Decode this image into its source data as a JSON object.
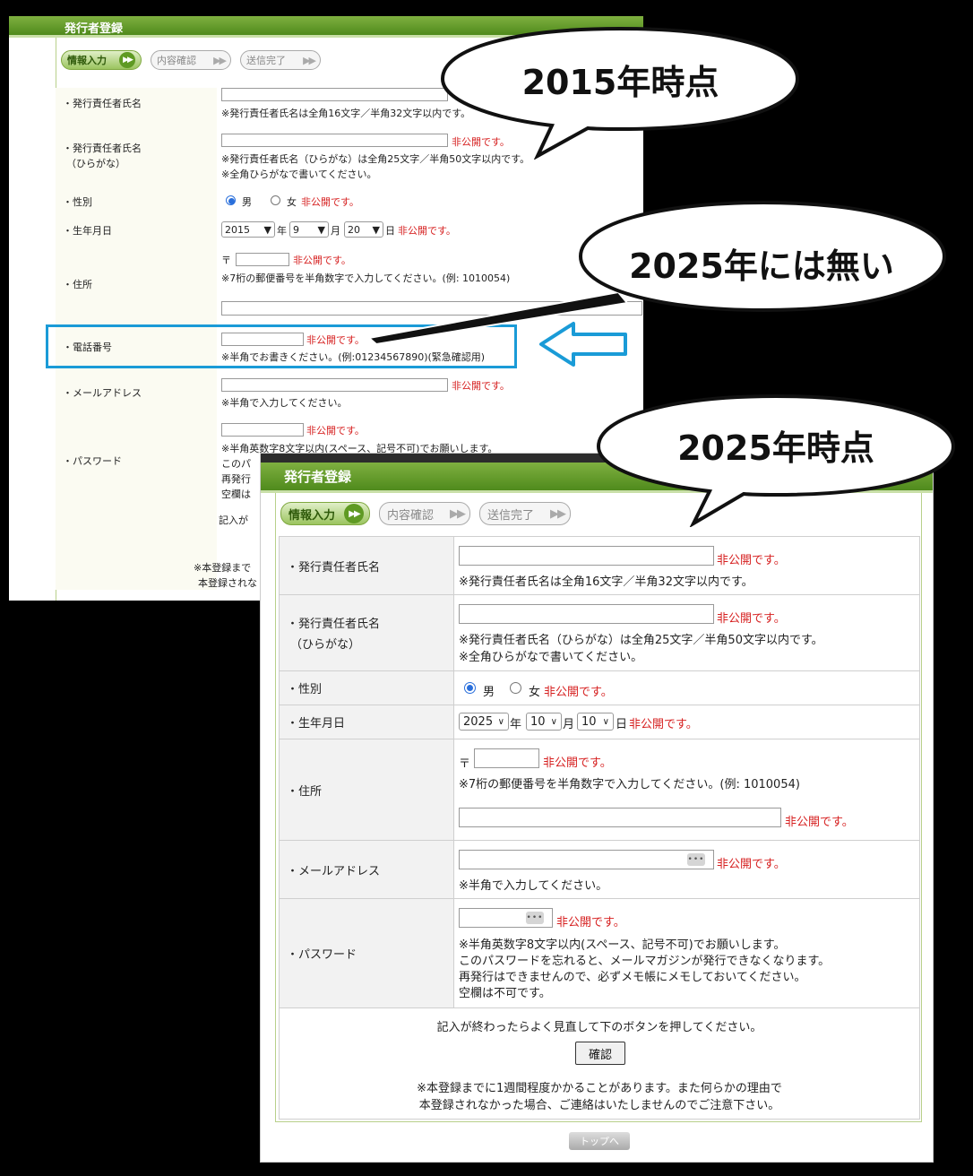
{
  "old_form": {
    "title": "発行者登録",
    "steps": [
      "情報入力",
      "内容確認",
      "送信完了"
    ],
    "rows": {
      "name_label": "・発行責任者氏名",
      "name_note": "※発行責任者氏名は全角16文字／半角32文字以内です。",
      "kana_label1": "・発行責任者氏名",
      "kana_label2": "（ひらがな）",
      "kana_private": "非公開です。",
      "kana_note1": "※発行責任者氏名（ひらがな）は全角25文字／半角50文字以内です。",
      "kana_note2": "※全角ひらがなで書いてください。",
      "gender_label": "・性別",
      "male": "男",
      "female": "女",
      "gender_private": "非公開です。",
      "birth_label": "・生年月日",
      "birth_year": "2015",
      "year_unit": "年",
      "birth_month": "9",
      "month_unit": "月",
      "birth_day": "20",
      "day_unit": "日",
      "birth_private": "非公開です。",
      "address_label": "・住所",
      "postal_mark": "〒",
      "postal_private": "非公開です。",
      "postal_note": "※7桁の郵便番号を半角数字で入力してください。(例: 1010054)",
      "phone_label": "・電話番号",
      "phone_private": "非公開です。",
      "phone_note": "※半角でお書きください。(例:01234567890)(緊急確認用)",
      "email_label": "・メールアドレス",
      "email_private": "非公開です。",
      "email_note": "※半角で入力してください。",
      "password_label": "・パスワード",
      "password_private": "非公開です。",
      "password_note1": "※半角英数字8文字以内(スペース、記号不可)でお願いします。",
      "password_note2": "このパ",
      "password_note3": "再発行",
      "password_note4": "空欄は",
      "footer1": "記入が",
      "footer2": "※本登録まで",
      "footer3": "本登録されな"
    }
  },
  "new_form": {
    "title": "発行者登録",
    "steps": [
      "情報入力",
      "内容確認",
      "送信完了"
    ],
    "name_label": "・発行責任者氏名",
    "name_private": "非公開です。",
    "name_note": "※発行責任者氏名は全角16文字／半角32文字以内です。",
    "kana_label1": "・発行責任者氏名",
    "kana_label2": "（ひらがな）",
    "kana_private": "非公開です。",
    "kana_note1": "※発行責任者氏名（ひらがな）は全角25文字／半角50文字以内です。",
    "kana_note2": "※全角ひらがなで書いてください。",
    "gender_label": "・性別",
    "male": "男",
    "female": "女",
    "gender_private": "非公開です。",
    "birth_label": "・生年月日",
    "birth_year": "2025",
    "year_unit": "年",
    "birth_month": "10",
    "month_unit": "月",
    "birth_day": "10",
    "day_unit": "日",
    "birth_private": "非公開です。",
    "address_label": "・住所",
    "postal_mark": "〒",
    "postal_private": "非公開です。",
    "postal_note": "※7桁の郵便番号を半角数字で入力してください。(例: 1010054)",
    "address_private": "非公開です。",
    "email_label": "・メールアドレス",
    "email_private": "非公開です。",
    "email_note": "※半角で入力してください。",
    "password_label": "・パスワード",
    "password_private": "非公開です。",
    "password_note1": "※半角英数字8文字以内(スペース、記号不可)でお願いします。",
    "password_note2": "このパスワードを忘れると、メールマガジンが発行できなくなります。",
    "password_note3": "再発行はできませんので、必ずメモ帳にメモしておいてください。",
    "password_note4": "空欄は不可です。",
    "confirm_instruction": "記入が終わったらよく見直して下のボタンを押してください。",
    "confirm_button": "確認",
    "notice1": "※本登録までに1週間程度かかることがあります。また何らかの理由で",
    "notice2": "本登録されなかった場合、ご連絡はいたしませんのでご注意下さい。",
    "top_button": "トップへ",
    "dots": "•••"
  },
  "callouts": {
    "c2015": "2015年時点",
    "c2025_missing": "2025年には無い",
    "c2025": "2025年時点"
  },
  "colors": {
    "highlight_box": "#1a9bd7",
    "private_red": "#d61f1f",
    "title_green": "#5f9a23"
  }
}
